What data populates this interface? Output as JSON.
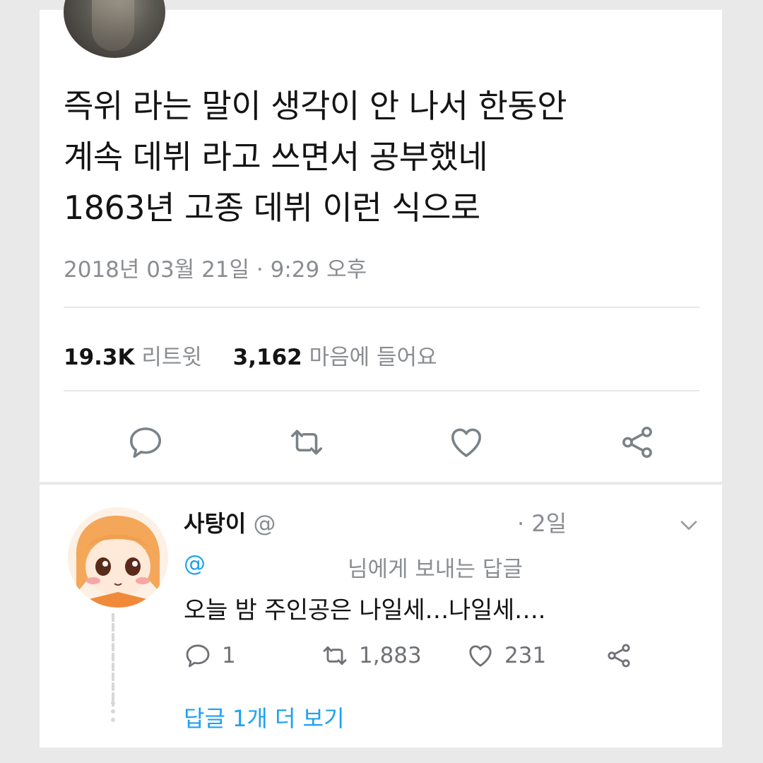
{
  "tweet": {
    "text_lines": [
      "즉위 라는 말이 생각이 안 나서 한동안",
      "계속 데뷔 라고 쓰면서 공부했네",
      "1863년 고종 데뷔 이런 식으로"
    ],
    "timestamp": "2018년 03월 21일 · 9:29 오후",
    "retweets_count": "19.3K",
    "retweets_label": "리트윗",
    "likes_count": "3,162",
    "likes_label": "마음에 들어요"
  },
  "reply": {
    "name": "사탕이",
    "handle": "@",
    "time": "· 2일",
    "reply_to_at": "@",
    "reply_to_label": "님에게 보내는 답글",
    "text": "오늘 밤 주인공은 나일세…나일세….",
    "reply_count": "1",
    "retweet_count": "1,883",
    "like_count": "231",
    "more_replies": "답글 1개 더 보기"
  },
  "icons": {
    "reply": "reply-icon",
    "retweet": "retweet-icon",
    "like": "heart-icon",
    "share": "share-icon",
    "menu": "chevron-down-icon"
  },
  "colors": {
    "accent": "#1da1f2",
    "icon": "#7b8287",
    "muted": "#8a8d91"
  }
}
